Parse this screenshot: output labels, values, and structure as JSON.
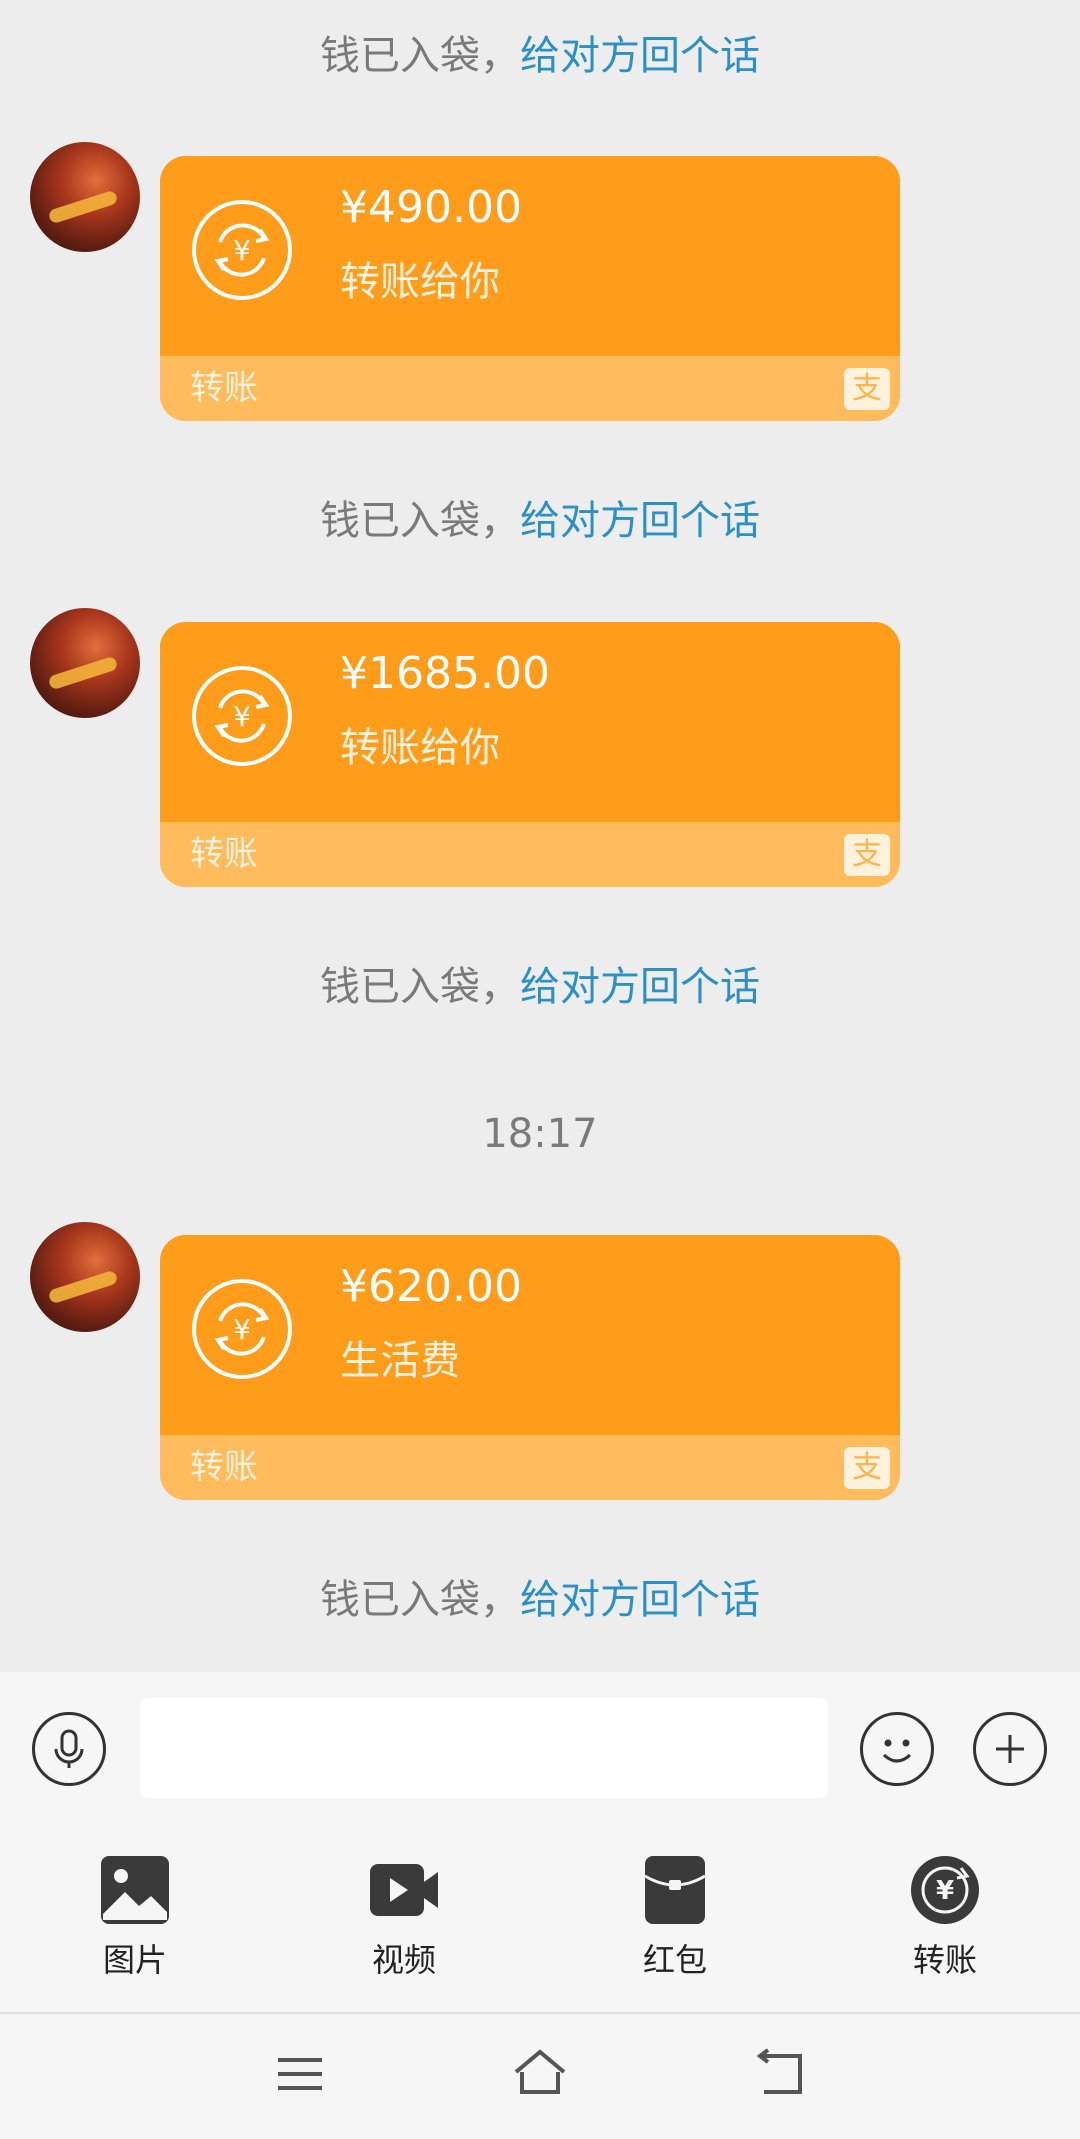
{
  "messages": {
    "notice_prefix": "钱已入袋，",
    "notice_reply": "给对方回个话",
    "transfers": [
      {
        "amount": "¥490.00",
        "desc": "转账给你",
        "footer_label": "转账",
        "pay_glyph": "支"
      },
      {
        "amount": "¥1685.00",
        "desc": "转账给你",
        "footer_label": "转账",
        "pay_glyph": "支"
      },
      {
        "amount": "¥620.00",
        "desc": "生活费",
        "footer_label": "转账",
        "pay_glyph": "支"
      }
    ],
    "timestamp": "18:17"
  },
  "input": {
    "placeholder": ""
  },
  "tools": [
    {
      "label": "图片",
      "icon": "image-icon"
    },
    {
      "label": "视频",
      "icon": "video-icon"
    },
    {
      "label": "红包",
      "icon": "red-packet-icon"
    },
    {
      "label": "转账",
      "icon": "transfer-icon"
    }
  ],
  "colors": {
    "card": "#ff9c1a",
    "card_footer": "#ffbb5c",
    "reply_link": "#2b8fc8"
  }
}
